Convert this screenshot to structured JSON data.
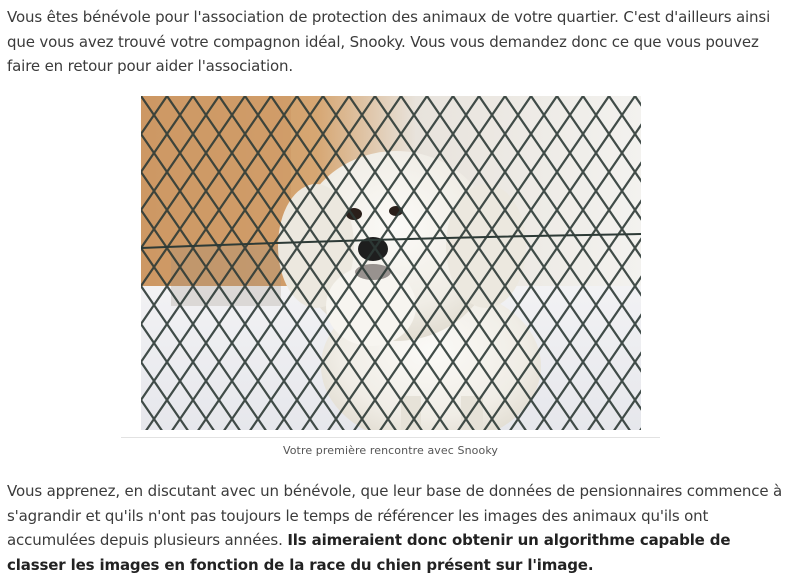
{
  "intro": {
    "text": "Vous êtes bénévole pour l'association de protection des animaux de votre quartier. C'est d'ailleurs ainsi que vous avez trouvé votre compagnon idéal, Snooky. Vous vous demandez donc ce que vous pouvez faire en retour pour aider l'association."
  },
  "figure": {
    "caption": "Votre première rencontre avec Snooky"
  },
  "body": {
    "text": "Vous apprenez, en discutant avec un bénévole, que leur base de données de pensionnaires commence à s'agrandir et qu'ils n'ont pas toujours le temps de référencer les images des animaux qu'ils ont accumulées depuis plusieurs années. ",
    "emphasis": "Ils aimeraient donc obtenir un algorithme capable de classer les images en fonction de la race du chien présent sur l'image."
  },
  "colors": {
    "text": "#3b3b3b",
    "emphasis": "#222222",
    "caption": "#555555",
    "rule": "#e2e2e2"
  }
}
